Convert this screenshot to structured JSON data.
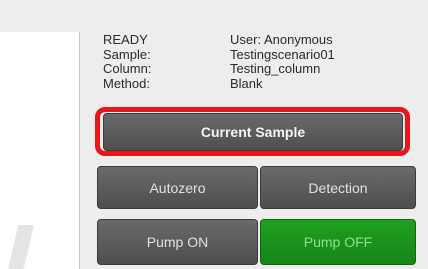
{
  "status": {
    "rows": [
      {
        "key": "READY",
        "value": "User: Anonymous"
      },
      {
        "key": "Sample:",
        "value": "Testingscenario01"
      },
      {
        "key": "Column:",
        "value": "Testing_column"
      },
      {
        "key": "Method:",
        "value": "Blank"
      }
    ]
  },
  "buttons": {
    "current_sample": "Current Sample",
    "autozero": "Autozero",
    "detection": "Detection",
    "pump_on": "Pump ON",
    "pump_off": "Pump OFF"
  },
  "colors": {
    "highlight": "#e8171c",
    "pump_off_bg": "#1c941c",
    "button_bg": "#5c5c5c"
  }
}
